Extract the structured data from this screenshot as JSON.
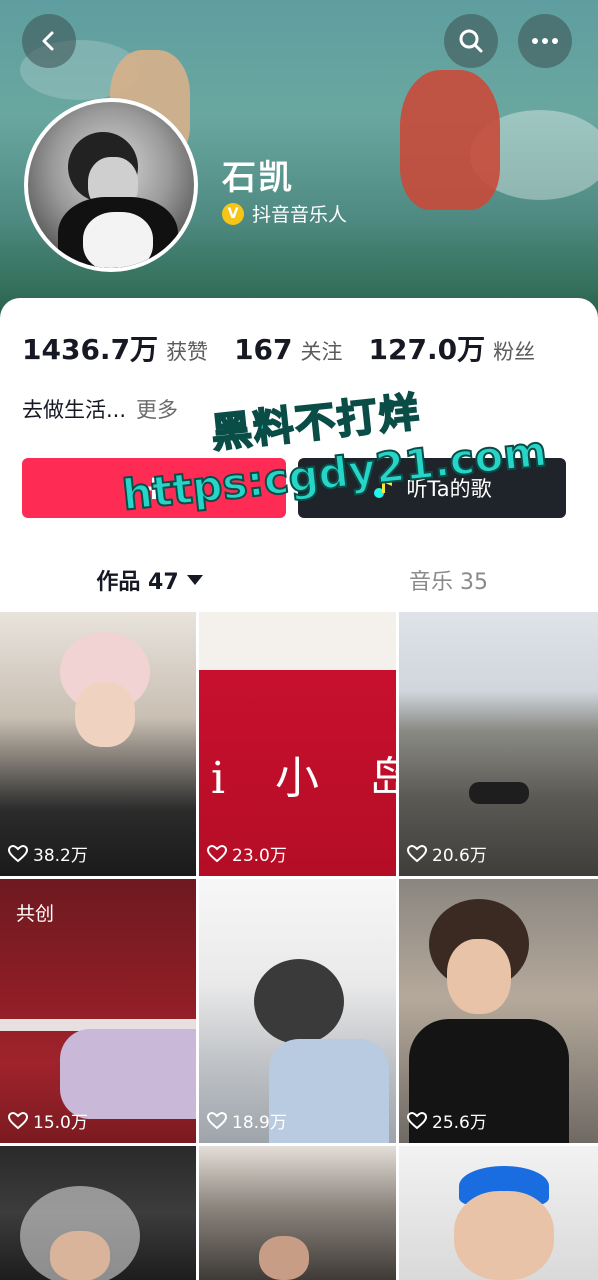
{
  "header": {
    "back_icon": "back-chevron-icon",
    "search_icon": "search-icon",
    "more_icon": "more-dots-icon"
  },
  "profile": {
    "name": "石凯",
    "verified_label": "抖音音乐人",
    "verified_badge": "V"
  },
  "stats": [
    {
      "value": "1436.7万",
      "label": "获赞"
    },
    {
      "value": "167",
      "label": "关注"
    },
    {
      "value": "127.0万",
      "label": "粉丝"
    }
  ],
  "bio": {
    "text": "去做生活...",
    "more": "更多"
  },
  "buttons": {
    "follow_icon": "+",
    "listen_label": "听Ta的歌"
  },
  "watermark": {
    "line1": "黑料不打烊",
    "line2": "https:cgdy21.com"
  },
  "tabs": [
    {
      "label": "作品 47"
    },
    {
      "label": "音乐 35"
    }
  ],
  "videos": [
    {
      "likes": "38.2万",
      "tag": ""
    },
    {
      "likes": "23.0万",
      "tag": "",
      "overlay_text": "i 小 岛"
    },
    {
      "likes": "20.6万",
      "tag": ""
    },
    {
      "likes": "15.0万",
      "tag": "共创"
    },
    {
      "likes": "18.9万",
      "tag": ""
    },
    {
      "likes": "25.6万",
      "tag": ""
    },
    {
      "likes": "",
      "tag": ""
    },
    {
      "likes": "",
      "tag": ""
    },
    {
      "likes": "",
      "tag": ""
    }
  ],
  "colors": {
    "accent": "#fe2c55",
    "dark_button": "#1f232a",
    "badge": "#f5c518"
  }
}
